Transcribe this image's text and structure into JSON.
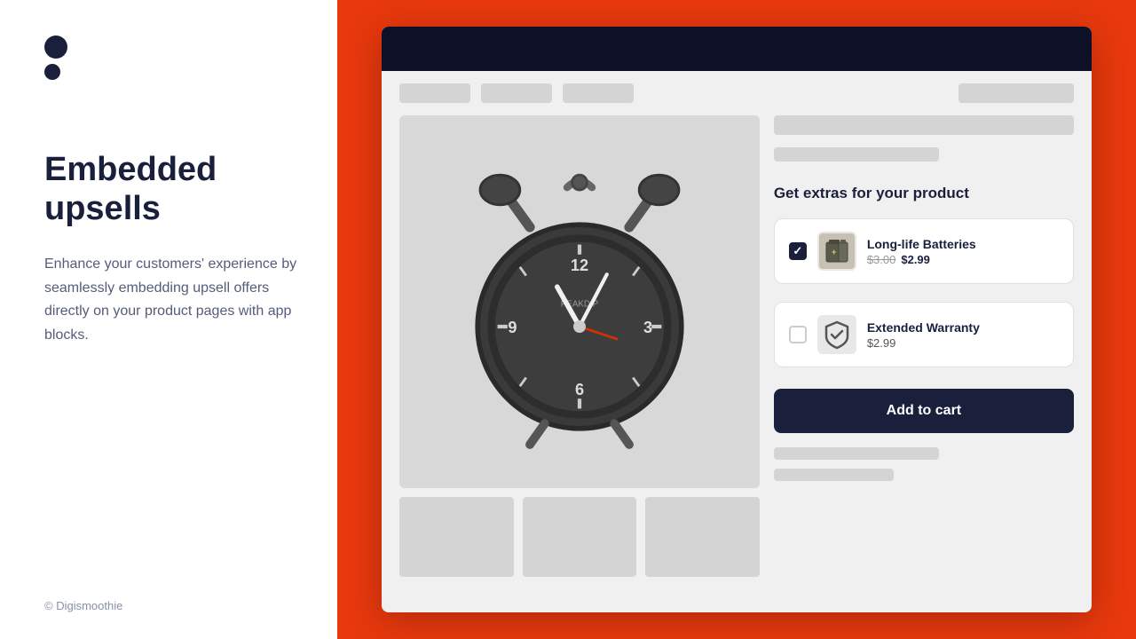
{
  "left": {
    "logo_alt": "Digismoothie logo",
    "title_line1": "Embedded",
    "title_line2": "upsells",
    "description": "Enhance your customers' experience by seamlessly embedding upsell offers directly on your product pages with app blocks.",
    "copyright": "© Digismoothie"
  },
  "browser": {
    "nav_pills": [
      "",
      "",
      ""
    ],
    "nav_pill_right": "",
    "heading": "Get extras for your product",
    "upsells": [
      {
        "id": "batteries",
        "name": "Long-life Batteries",
        "price_original": "$3.00",
        "price_sale": "$2.99",
        "checked": true
      },
      {
        "id": "warranty",
        "name": "Extended Warranty",
        "price_original": null,
        "price_sale": "$2.99",
        "checked": false
      }
    ],
    "add_to_cart_label": "Add to cart"
  }
}
